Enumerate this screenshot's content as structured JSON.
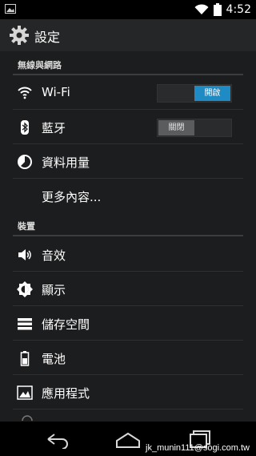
{
  "status_bar": {
    "time": "4:52",
    "icons": [
      "image-notification-icon",
      "wifi-icon",
      "battery-icon"
    ]
  },
  "action_bar": {
    "title": "設定",
    "icon": "gear-icon"
  },
  "sections": {
    "wireless": {
      "header": "無線與網路"
    },
    "device": {
      "header": "裝置"
    }
  },
  "wireless_items": {
    "wifi": {
      "label": "Wi-Fi",
      "toggle": "開啟",
      "state": "on",
      "icon": "wifi-icon"
    },
    "bluetooth": {
      "label": "藍牙",
      "toggle": "關閉",
      "state": "off",
      "icon": "bluetooth-icon"
    },
    "data_usage": {
      "label": "資料用量",
      "icon": "data-usage-icon"
    },
    "more": {
      "label": "更多內容..."
    }
  },
  "device_items": {
    "sound": {
      "label": "音效",
      "icon": "speaker-icon"
    },
    "display": {
      "label": "顯示",
      "icon": "brightness-icon"
    },
    "storage": {
      "label": "儲存空間",
      "icon": "storage-icon"
    },
    "battery": {
      "label": "電池",
      "icon": "battery-icon"
    },
    "apps": {
      "label": "應用程式",
      "icon": "apps-icon"
    }
  },
  "nav_bar": {
    "buttons": [
      "back-icon",
      "home-icon",
      "recents-icon"
    ]
  },
  "watermark": "jk_munin111@sogi.com.tw",
  "colors": {
    "accent": "#1e8bc4",
    "background": "#1c1d1e",
    "action_bar": "#252627"
  }
}
